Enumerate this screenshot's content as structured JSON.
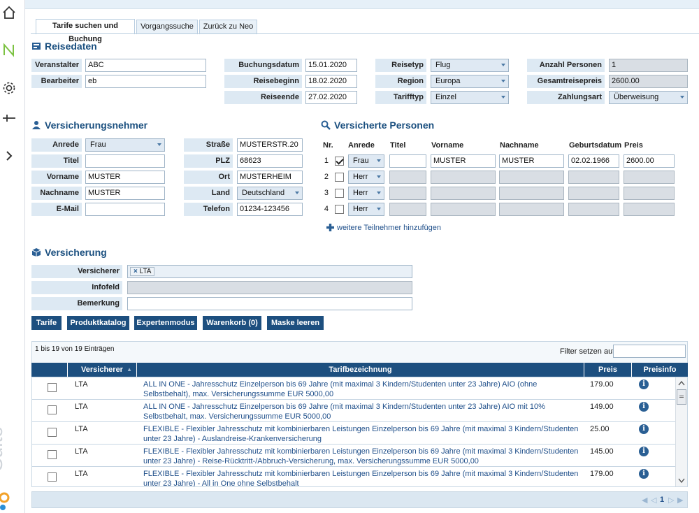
{
  "sidebar": {
    "icons": [
      "home-icon",
      "neo-n-icon",
      "gear-icon",
      "plus-minus-icon",
      "chevron-right-icon"
    ],
    "brand": "Suite"
  },
  "tabs": [
    "Tarife suchen und Buchung",
    "Vorgangssuche",
    "Zurück zu Neo"
  ],
  "reisedaten": {
    "title": "Reisedaten",
    "veranstalter_label": "Veranstalter",
    "veranstalter": "ABC",
    "bearbeiter_label": "Bearbeiter",
    "bearbeiter": "eb",
    "buchungsdatum_label": "Buchungsdatum",
    "buchungsdatum": "15.01.2020",
    "reisebeginn_label": "Reisebeginn",
    "reisebeginn": "18.02.2020",
    "reiseende_label": "Reiseende",
    "reiseende": "27.02.2020",
    "reisetyp_label": "Reisetyp",
    "reisetyp": "Flug",
    "region_label": "Region",
    "region": "Europa",
    "tarifftyp_label": "Tarifftyp",
    "tarifftyp": "Einzel",
    "anzahl_label": "Anzahl Personen",
    "anzahl": "1",
    "gesamtpreis_label": "Gesamtreisepreis",
    "gesamtpreis": "2600.00",
    "zahlungsart_label": "Zahlungsart",
    "zahlungsart": "Überweisung"
  },
  "vn": {
    "title": "Versicherungsnehmer",
    "anrede_label": "Anrede",
    "anrede": "Frau",
    "titel_label": "Titel",
    "titel": "",
    "vorname_label": "Vorname",
    "vorname": "MUSTER",
    "nachname_label": "Nachname",
    "nachname": "MUSTER",
    "email_label": "E-Mail",
    "email": "",
    "strasse_label": "Straße",
    "strasse": "MUSTERSTR.20",
    "plz_label": "PLZ",
    "plz": "68623",
    "ort_label": "Ort",
    "ort": "MUSTERHEIM",
    "land_label": "Land",
    "land": "Deutschland",
    "telefon_label": "Telefon",
    "telefon": "01234-123456"
  },
  "vp": {
    "title": "Versicherte Personen",
    "headers": [
      "Nr.",
      "Anrede",
      "Titel",
      "Vorname",
      "Nachname",
      "Geburtsdatum",
      "Preis"
    ],
    "rows": [
      {
        "nr": "1",
        "checked": true,
        "anrede": "Frau",
        "titel": "",
        "vorname": "MUSTER",
        "nachname": "MUSTER",
        "geb": "02.02.1966",
        "preis": "2600.00"
      },
      {
        "nr": "2",
        "checked": false,
        "anrede": "Herr",
        "titel": "",
        "vorname": "",
        "nachname": "",
        "geb": "",
        "preis": ""
      },
      {
        "nr": "3",
        "checked": false,
        "anrede": "Herr",
        "titel": "",
        "vorname": "",
        "nachname": "",
        "geb": "",
        "preis": ""
      },
      {
        "nr": "4",
        "checked": false,
        "anrede": "Herr",
        "titel": "",
        "vorname": "",
        "nachname": "",
        "geb": "",
        "preis": ""
      }
    ],
    "add_label": "weitere Teilnehmer hinzufügen"
  },
  "vers": {
    "title": "Versicherung",
    "versicherer_label": "Versicherer",
    "versicherer_chip": "LTA",
    "infofeld_label": "Infofeld",
    "bemerkung_label": "Bemerkung"
  },
  "buttons": [
    "Tarife",
    "Produktkatalog",
    "Expertenmodus",
    "Warenkorb (0)",
    "Maske leeren"
  ],
  "table": {
    "info": "1 bis 19 von 19 Einträgen",
    "filter_label": "Filter setzen auf",
    "headers": [
      "Versicherer",
      "Tarifbezeichnung",
      "Preis",
      "Preisinfo"
    ],
    "rows": [
      {
        "vs": "LTA",
        "tb": "ALL IN ONE - Jahresschutz Einzelperson bis 69 Jahre (mit maximal 3 Kindern/Studenten unter 23 Jahre) AIO (ohne Selbstbehalt), max. Versicherungssumme EUR 5000,00",
        "preis": "179.00"
      },
      {
        "vs": "LTA",
        "tb": "ALL IN ONE - Jahresschutz Einzelperson bis 69 Jahre (mit maximal 3 Kindern/Studenten unter 23 Jahre) AIO mit 10% Selbstbehalt, max. Versicherungssumme EUR 5000,00",
        "preis": "149.00"
      },
      {
        "vs": "LTA",
        "tb": "FLEXIBLE - Flexibler Jahresschutz mit kombinierbaren Leistungen Einzelperson bis 69 Jahre (mit maximal 3 Kindern/Studenten unter 23 Jahre) - Auslandreise-Krankenversicherung",
        "preis": "25.00"
      },
      {
        "vs": "LTA",
        "tb": "FLEXIBLE - Flexibler Jahresschutz mit kombinierbaren Leistungen Einzelperson bis 69 Jahre (mit maximal 3 Kindern/Studenten unter 23 Jahre) - Reise-Rücktritt-/Abbruch-Versicherung, max. Versicherungssumme EUR 5000,00",
        "preis": "145.00"
      },
      {
        "vs": "LTA",
        "tb": "FLEXIBLE - Flexibler Jahresschutz mit kombinierbaren Leistungen Einzelperson bis 69 Jahre (mit maximal 3 Kindern/Studenten unter 23 Jahre) - All in One ohne Selbstbehalt",
        "preis": "179.00"
      }
    ],
    "page": "1"
  }
}
